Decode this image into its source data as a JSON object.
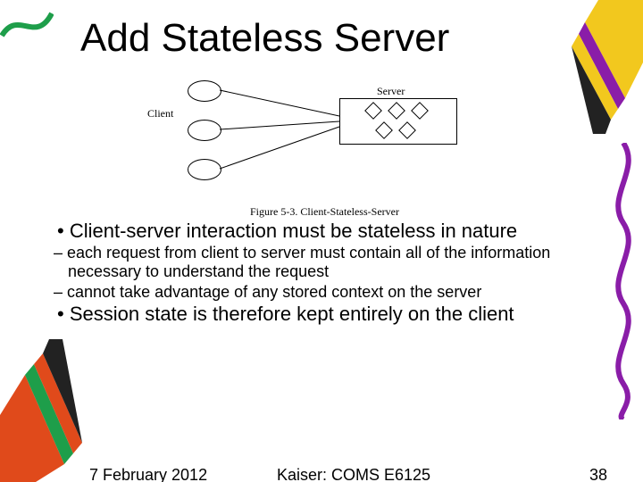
{
  "title": "Add Stateless Server",
  "figure": {
    "client_label": "Client",
    "server_label": "Server",
    "caption": "Figure 5-3. Client-Stateless-Server"
  },
  "bullets": {
    "b1": "Client-server interaction must be stateless in nature",
    "sub1": "each request from client to server must contain all of the information necessary to understand the request",
    "sub2": "cannot take advantage of any stored context on the server",
    "b2": "Session state is therefore kept entirely on the client"
  },
  "footer": {
    "date": "7 February 2012",
    "center": "Kaiser: COMS E6125",
    "page": "38"
  }
}
